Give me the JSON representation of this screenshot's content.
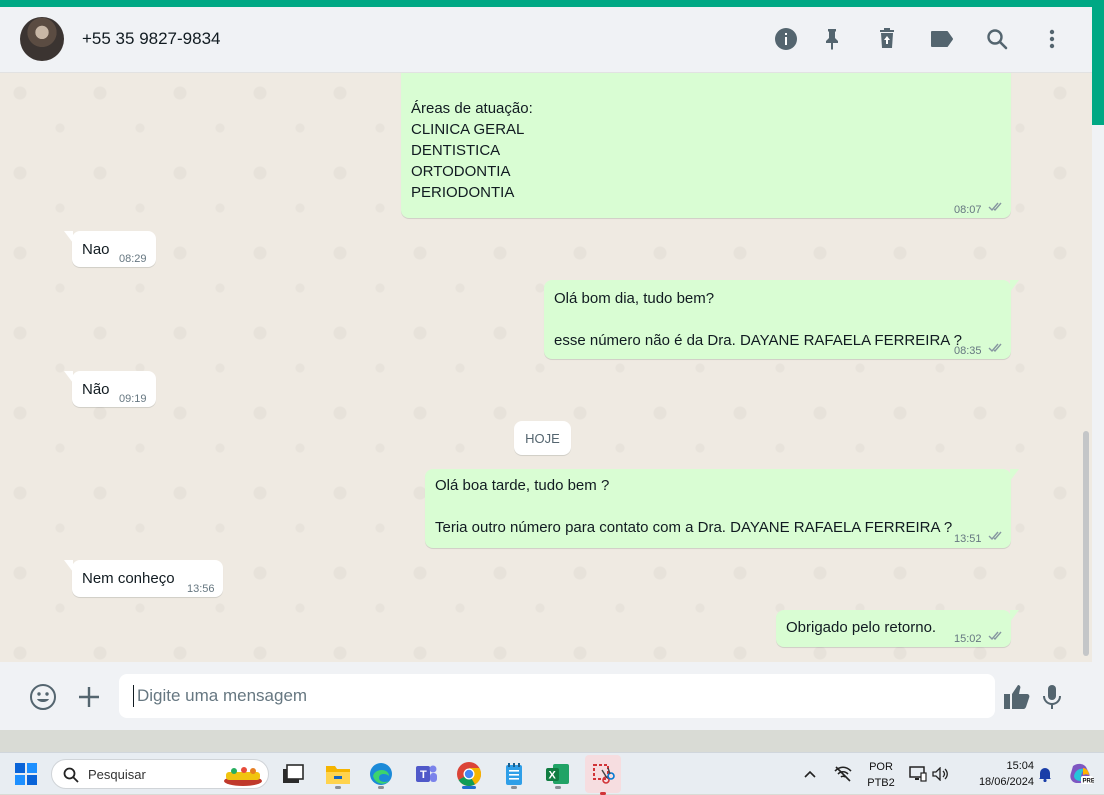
{
  "header": {
    "contact_name": "+55 35 9827-9834",
    "icons": [
      "info-icon",
      "pin-icon",
      "delete-icon",
      "label-icon",
      "search-icon",
      "menu-icon"
    ]
  },
  "messages": [
    {
      "direction": "out",
      "lines": [
        "Áreas de atuação:",
        "CLINICA GERAL",
        "DENTISTICA",
        "ORTODONTIA",
        "PERIODONTIA"
      ],
      "time": "08:07",
      "status": "read"
    },
    {
      "direction": "in",
      "lines": [
        "Nao"
      ],
      "time": "08:29"
    },
    {
      "direction": "out",
      "lines": [
        "Olá bom dia, tudo bem?",
        "",
        "esse número não é da Dra. DAYANE RAFAELA FERREIRA ?"
      ],
      "time": "08:35",
      "status": "read"
    },
    {
      "direction": "in",
      "lines": [
        "Não"
      ],
      "time": "09:19"
    },
    {
      "direction": "out",
      "lines": [
        "Olá boa tarde, tudo bem ?",
        "",
        "Teria outro número para contato com a Dra. DAYANE RAFAELA FERREIRA ?"
      ],
      "time": "13:51",
      "status": "read"
    },
    {
      "direction": "in",
      "lines": [
        "Nem conheço"
      ],
      "time": "13:56"
    },
    {
      "direction": "out",
      "lines": [
        "Obrigado pelo retorno."
      ],
      "time": "15:02",
      "status": "read"
    }
  ],
  "day_separator": "HOJE",
  "composer": {
    "placeholder": "Digite uma mensagem",
    "icons": [
      "emoji-icon",
      "attach-plus-icon",
      "thumbs-up-icon",
      "microphone-icon"
    ]
  },
  "taskbar": {
    "search_label": "Pesquisar",
    "language_top": "POR",
    "language_bottom": "PTB2",
    "clock_time": "15:04",
    "clock_date": "18/06/2024",
    "apps": [
      "task-view-icon",
      "file-explorer-icon",
      "edge-icon",
      "teams-icon",
      "chrome-icon",
      "notepad-icon",
      "excel-icon",
      "snipping-tool-icon"
    ]
  },
  "colors": {
    "accent": "#00a884",
    "outgoing_bubble": "#d9fdd3",
    "incoming_bubble": "#ffffff",
    "chat_background": "#efeae2",
    "read_ticks": "#8696a0"
  }
}
